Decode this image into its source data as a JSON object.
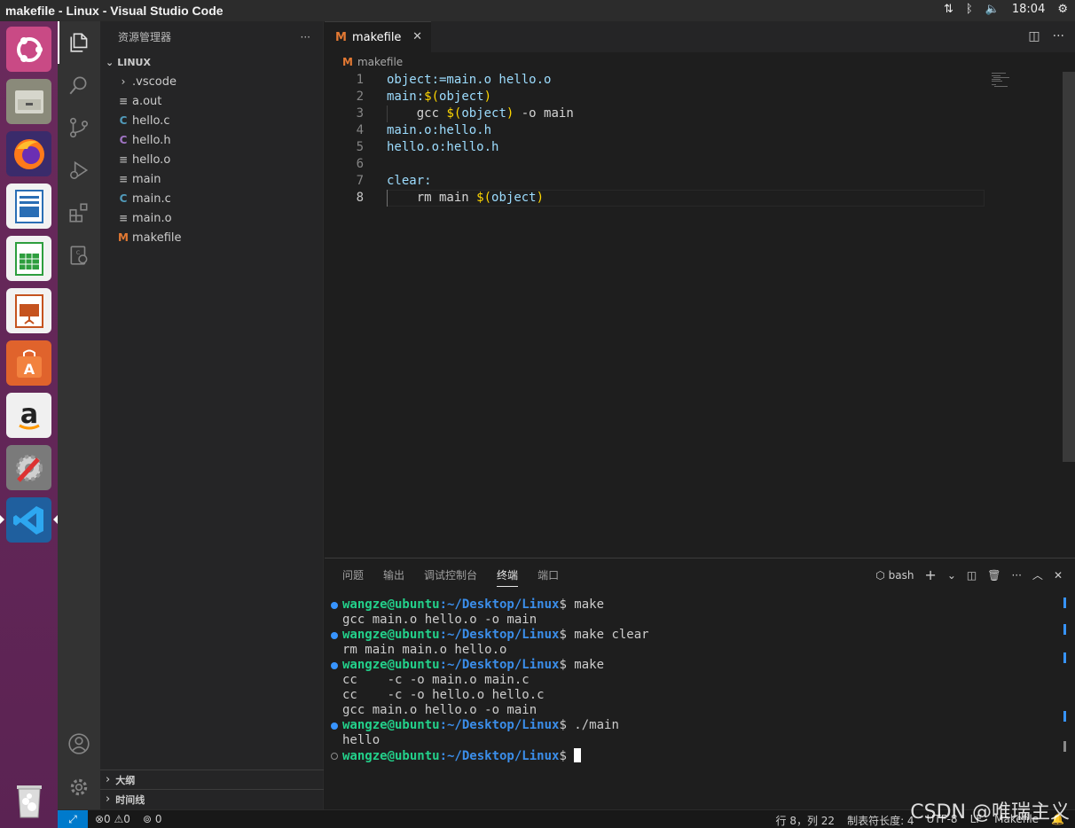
{
  "window": {
    "title": "makefile - Linux - Visual Studio Code"
  },
  "tray": {
    "network_icon": "network-icon",
    "bluetooth_icon": "bluetooth-icon",
    "volume_icon": "volume-icon",
    "time": "18:04",
    "power_icon": "power-gear-icon"
  },
  "launcher": {
    "apps": [
      "ubuntu-logo",
      "files",
      "firefox",
      "writer",
      "calc",
      "impress",
      "software-center",
      "amazon",
      "system-settings",
      "vscode",
      "trash"
    ]
  },
  "sidebar": {
    "title": "资源管理器",
    "more": "···",
    "folder": "LINUX",
    "items": [
      {
        "label": ".vscode",
        "type": "folder"
      },
      {
        "label": "a.out",
        "type": "file"
      },
      {
        "label": "hello.c",
        "type": "c"
      },
      {
        "label": "hello.h",
        "type": "h"
      },
      {
        "label": "hello.o",
        "type": "file"
      },
      {
        "label": "main",
        "type": "file"
      },
      {
        "label": "main.c",
        "type": "c"
      },
      {
        "label": "main.o",
        "type": "file"
      },
      {
        "label": "makefile",
        "type": "make"
      }
    ],
    "outline": "大纲",
    "timeline": "时间线"
  },
  "editor": {
    "tab_label": "makefile",
    "tab_icon": "M",
    "close": "✕",
    "breadcrumb": "makefile",
    "lines": [
      {
        "n": "1",
        "text": "object:=main.o hello.o"
      },
      {
        "n": "2",
        "text": "main:$(object)"
      },
      {
        "n": "3",
        "text": "    gcc $(object) -o main"
      },
      {
        "n": "4",
        "text": "main.o:hello.h"
      },
      {
        "n": "5",
        "text": "hello.o:hello.h"
      },
      {
        "n": "6",
        "text": ""
      },
      {
        "n": "7",
        "text": "clear:"
      },
      {
        "n": "8",
        "text": "    rm main $(object)"
      }
    ]
  },
  "panel": {
    "tabs": [
      "问题",
      "输出",
      "调试控制台",
      "终端",
      "端口"
    ],
    "active_tab": "终端",
    "shell": "bash",
    "terminal": [
      {
        "dot": "blue",
        "user": "wangze@ubuntu",
        "path": ":~/Desktop/Linux",
        "cmd": "$ make"
      },
      {
        "out": "gcc main.o hello.o -o main"
      },
      {
        "dot": "blue",
        "user": "wangze@ubuntu",
        "path": ":~/Desktop/Linux",
        "cmd": "$ make clear"
      },
      {
        "out": "rm main main.o hello.o"
      },
      {
        "dot": "blue",
        "user": "wangze@ubuntu",
        "path": ":~/Desktop/Linux",
        "cmd": "$ make"
      },
      {
        "out": "cc    -c -o main.o main.c"
      },
      {
        "out": "cc    -c -o hello.o hello.c"
      },
      {
        "out": "gcc main.o hello.o -o main"
      },
      {
        "dot": "blue",
        "user": "wangze@ubuntu",
        "path": ":~/Desktop/Linux",
        "cmd": "$ ./main"
      },
      {
        "out": "hello"
      },
      {
        "dot": "hollow",
        "user": "wangze@ubuntu",
        "path": ":~/Desktop/Linux",
        "cmd": "$ "
      }
    ]
  },
  "statusbar": {
    "errors": "⊗0",
    "warnings": "⚠0",
    "ports": "0",
    "position": "行 8，列 22",
    "indent": "制表符长度: 4",
    "encoding": "UTF-8",
    "eol": "LF",
    "language": "Makefile"
  },
  "watermark": "CSDN @唯瑞主义",
  "colors": {
    "accent": "#007acc",
    "launcher": "#5e2750",
    "prompt_user": "#23d18b",
    "prompt_path": "#3b8eea"
  }
}
